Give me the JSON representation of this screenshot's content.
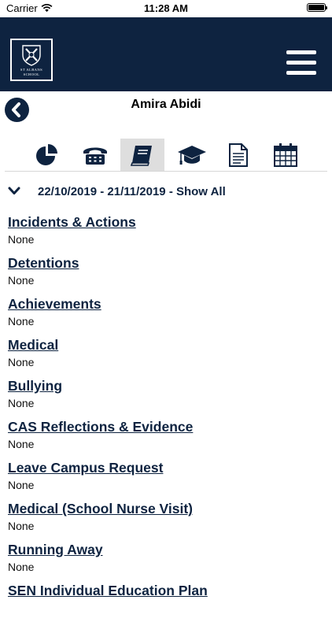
{
  "status_bar": {
    "carrier": "Carrier",
    "time": "11:28 AM"
  },
  "header": {
    "logo_line1": "ST ALBANS",
    "logo_line2": "SCHOOL",
    "brand_color": "#0e2340",
    "menu_icon": "hamburger-menu-icon"
  },
  "student": {
    "name": "Amira Abidi"
  },
  "tabs": [
    {
      "icon": "pie-chart-icon",
      "active": false
    },
    {
      "icon": "telephone-icon",
      "active": false
    },
    {
      "icon": "book-icon",
      "active": true
    },
    {
      "icon": "graduation-cap-icon",
      "active": false
    },
    {
      "icon": "document-icon",
      "active": false
    },
    {
      "icon": "calendar-icon",
      "active": false
    }
  ],
  "date_range": {
    "text": "22/10/2019 - 21/11/2019 - Show All"
  },
  "sections": [
    {
      "title": "Incidents & Actions",
      "value": "None"
    },
    {
      "title": "Detentions",
      "value": "None"
    },
    {
      "title": "Achievements",
      "value": "None"
    },
    {
      "title": "Medical",
      "value": "None"
    },
    {
      "title": "Bullying",
      "value": "None"
    },
    {
      "title": "CAS Reflections & Evidence",
      "value": "None"
    },
    {
      "title": "Leave Campus Request",
      "value": "None"
    },
    {
      "title": "Medical (School Nurse Visit)",
      "value": "None"
    },
    {
      "title": "Running Away",
      "value": "None"
    },
    {
      "title": "SEN Individual Education Plan",
      "value": ""
    }
  ]
}
